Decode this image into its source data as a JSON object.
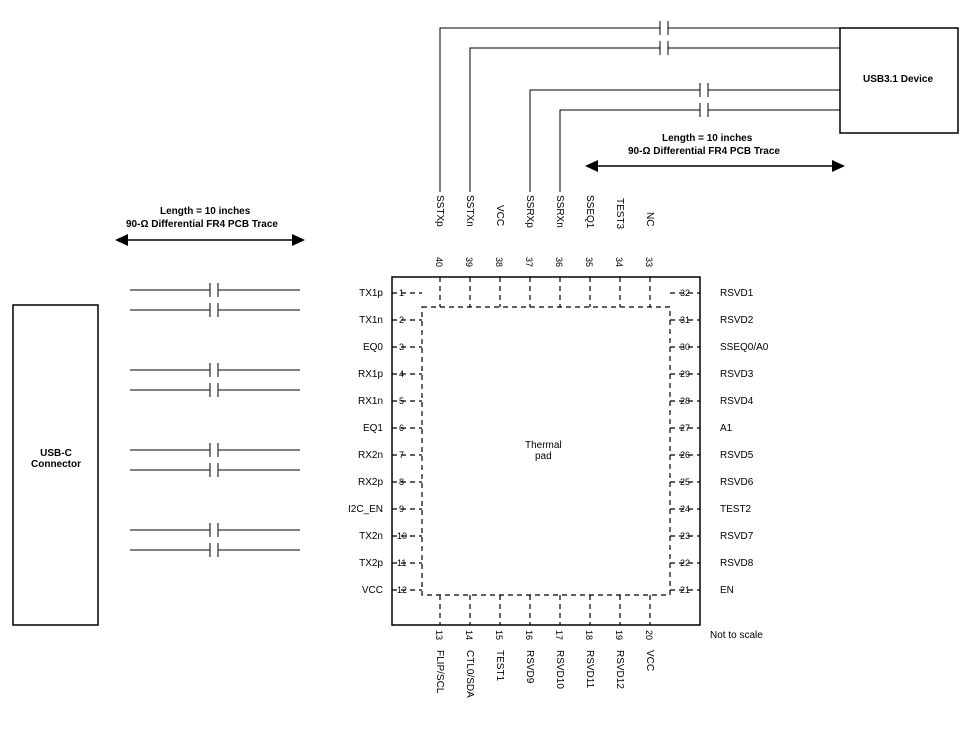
{
  "blocks": {
    "usbc": "USB-C\nConnector",
    "usb31": "USB3.1 Device",
    "thermal": "Thermal\npad"
  },
  "traces": {
    "left_line1": "Length = 10 inches",
    "left_line2": "90-Ω Differential FR4 PCB Trace",
    "right_line1": "Length = 10 inches",
    "right_line2": "90-Ω Differential FR4 PCB Trace"
  },
  "notscale": "Not to scale",
  "pins_left": [
    {
      "n": "1",
      "name": "TX1p"
    },
    {
      "n": "2",
      "name": "TX1n"
    },
    {
      "n": "3",
      "name": "EQ0"
    },
    {
      "n": "4",
      "name": "RX1p"
    },
    {
      "n": "5",
      "name": "RX1n"
    },
    {
      "n": "6",
      "name": "EQ1"
    },
    {
      "n": "7",
      "name": "RX2n"
    },
    {
      "n": "8",
      "name": "RX2p"
    },
    {
      "n": "9",
      "name": "I2C_EN"
    },
    {
      "n": "10",
      "name": "TX2n"
    },
    {
      "n": "11",
      "name": "TX2p"
    },
    {
      "n": "12",
      "name": "VCC"
    }
  ],
  "pins_right": [
    {
      "n": "32",
      "name": "RSVD1"
    },
    {
      "n": "31",
      "name": "RSVD2"
    },
    {
      "n": "30",
      "name": "SSEQ0/A0"
    },
    {
      "n": "29",
      "name": "RSVD3"
    },
    {
      "n": "28",
      "name": "RSVD4"
    },
    {
      "n": "27",
      "name": "A1"
    },
    {
      "n": "26",
      "name": "RSVD5"
    },
    {
      "n": "25",
      "name": "RSVD6"
    },
    {
      "n": "24",
      "name": "TEST2"
    },
    {
      "n": "23",
      "name": "RSVD7"
    },
    {
      "n": "22",
      "name": "RSVD8"
    },
    {
      "n": "21",
      "name": "EN"
    }
  ],
  "pins_top": [
    {
      "n": "40",
      "name": "SSTXp"
    },
    {
      "n": "39",
      "name": "SSTXn"
    },
    {
      "n": "38",
      "name": "VCC"
    },
    {
      "n": "37",
      "name": "SSRXp"
    },
    {
      "n": "36",
      "name": "SSRXn"
    },
    {
      "n": "35",
      "name": "SSEQ1"
    },
    {
      "n": "34",
      "name": "TEST3"
    },
    {
      "n": "33",
      "name": "NC"
    }
  ],
  "pins_bottom": [
    {
      "n": "13",
      "name": "FLIP/SCL"
    },
    {
      "n": "14",
      "name": "CTL0/SDA"
    },
    {
      "n": "15",
      "name": "TEST1"
    },
    {
      "n": "16",
      "name": "RSVD9"
    },
    {
      "n": "17",
      "name": "RSVD10"
    },
    {
      "n": "18",
      "name": "RSVD11"
    },
    {
      "n": "19",
      "name": "RSVD12"
    },
    {
      "n": "20",
      "name": "VCC"
    }
  ]
}
